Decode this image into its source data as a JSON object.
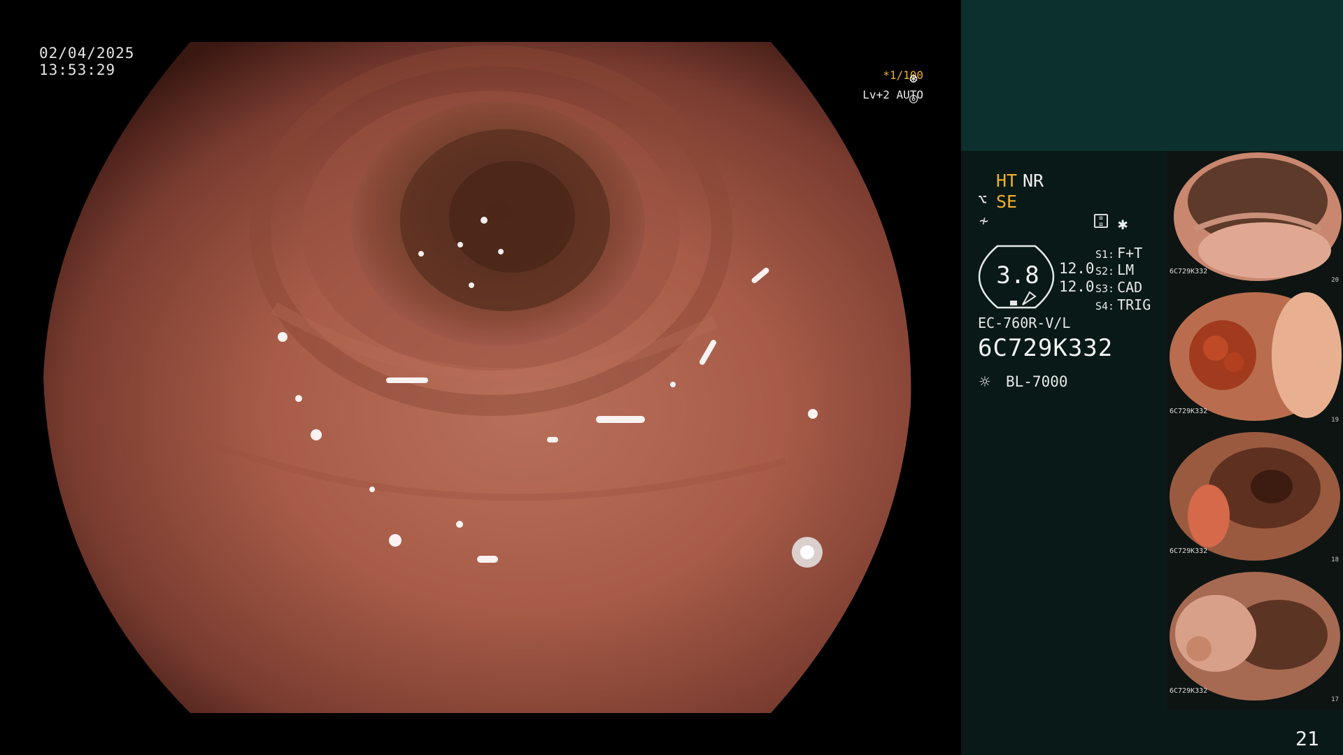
{
  "header": {
    "date": "02/04/2025",
    "time": "13:53:29"
  },
  "exposure": {
    "shutter": "*1/100",
    "iris": "Lv+2 AUTO",
    "shutter_icon": "shutter-icon",
    "iris_icon": "iris-icon"
  },
  "panel": {
    "ht": "HT",
    "nr": "NR",
    "se": "SE",
    "zoom": "3.8",
    "zoom_level_1": "12.0",
    "zoom_level_2": "12.0",
    "switches": [
      {
        "key": "S1:",
        "value": "F+T"
      },
      {
        "key": "S2:",
        "value": "LM"
      },
      {
        "key": "S3:",
        "value": "CAD"
      },
      {
        "key": "S4:",
        "value": "TRIG"
      }
    ],
    "model": "EC-760R-V/L",
    "serial": "6C729K332",
    "light_source": "BL-7000",
    "page": "21"
  },
  "thumbnails": [
    {
      "index": "20",
      "serial": "6C729K332"
    },
    {
      "index": "19",
      "serial": "6C729K332"
    },
    {
      "index": "18",
      "serial": "6C729K332"
    },
    {
      "index": "17",
      "serial": "6C729K332"
    }
  ],
  "colors": {
    "panel_top": "#0c302d",
    "panel": "#081917",
    "accent": "#f0b030"
  }
}
